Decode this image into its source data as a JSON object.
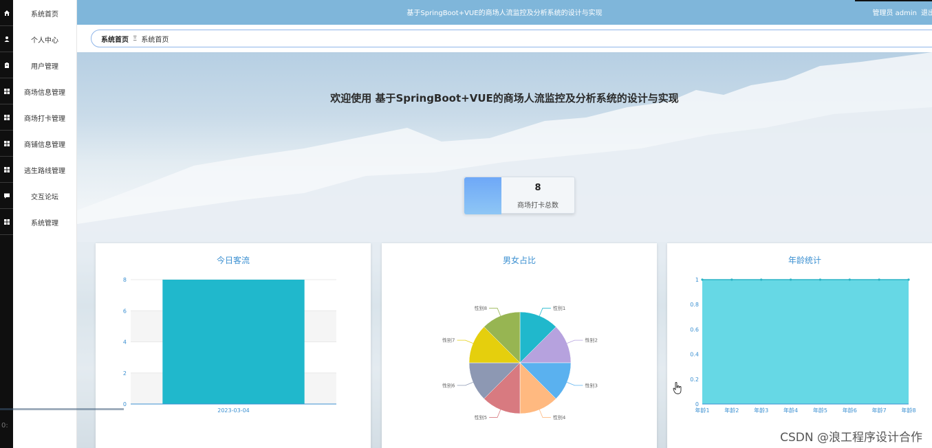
{
  "header": {
    "title": "基于SpringBoot+VUE的商场人流监控及分析系统的设计与实现",
    "user": "管理员 admin",
    "logout": "退出"
  },
  "sidebar": {
    "items": [
      {
        "label": "系统首页",
        "icon": "home-icon"
      },
      {
        "label": "个人中心",
        "icon": "user-icon"
      },
      {
        "label": "用户管理",
        "icon": "clipboard-icon"
      },
      {
        "label": "商场信息管理",
        "icon": "grid-icon"
      },
      {
        "label": "商场打卡管理",
        "icon": "grid-icon"
      },
      {
        "label": "商铺信息管理",
        "icon": "grid-icon"
      },
      {
        "label": "逃生路线管理",
        "icon": "grid-icon"
      },
      {
        "label": "交互论坛",
        "icon": "chat-icon"
      },
      {
        "label": "系统管理",
        "icon": "grid-icon"
      }
    ]
  },
  "breadcrumb": {
    "home": "系统首页",
    "separator": "Ξ",
    "current": "系统首页"
  },
  "welcome": "欢迎使用 基于SpringBoot+VUE的商场人流监控及分析系统的设计与实现",
  "stat": {
    "value": "8",
    "label": "商场打卡总数"
  },
  "chart_data": [
    {
      "type": "bar",
      "title": "今日客流",
      "categories": [
        "2023-03-04"
      ],
      "values": [
        8
      ],
      "ylim": [
        0,
        8
      ],
      "yticks": [
        "0",
        "2",
        "4",
        "6",
        "8"
      ],
      "color": "#20b8cc"
    },
    {
      "type": "pie",
      "title": "男女占比",
      "labels": [
        "性别1",
        "性别2",
        "性别3",
        "性别4",
        "性别5",
        "性别6",
        "性别7",
        "性别8"
      ],
      "values": [
        1,
        1,
        1,
        1,
        1,
        1,
        1,
        1
      ],
      "colors": [
        "#20b8cc",
        "#b6a2de",
        "#5ab1ef",
        "#ffb980",
        "#d87a80",
        "#8d98b3",
        "#e5cf0d",
        "#97b552"
      ]
    },
    {
      "type": "area",
      "title": "年龄统计",
      "categories": [
        "年龄1",
        "年龄2",
        "年龄3",
        "年龄4",
        "年龄5",
        "年龄6",
        "年龄7",
        "年龄8"
      ],
      "values": [
        1,
        1,
        1,
        1,
        1,
        1,
        1,
        1
      ],
      "ylim": [
        0,
        1
      ],
      "yticks": [
        "0",
        "0.2",
        "0.4",
        "0.6",
        "0.8",
        "1"
      ],
      "color": "#5ed6e4"
    }
  ],
  "watermark": "CSDN @浪工程序设计合作",
  "corner_text": "0:"
}
